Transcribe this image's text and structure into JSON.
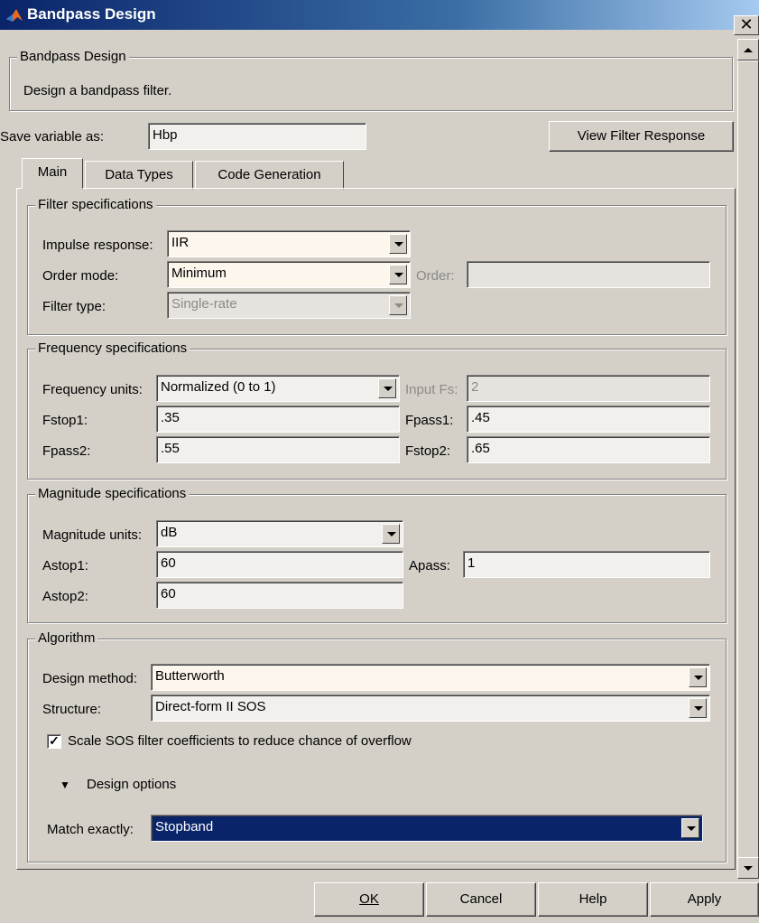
{
  "window": {
    "title": "Bandpass Design",
    "close_label": "✕"
  },
  "header": {
    "group_title": "Bandpass Design",
    "description": "Design a bandpass filter."
  },
  "save": {
    "label": "Save variable as:",
    "value": "Hbp",
    "view_button": "View Filter Response"
  },
  "tabs": [
    {
      "label": "Main"
    },
    {
      "label": "Data Types"
    },
    {
      "label": "Code Generation"
    }
  ],
  "filter_specs": {
    "title": "Filter specifications",
    "impulse_label": "Impulse response:",
    "impulse_value": "IIR",
    "order_mode_label": "Order mode:",
    "order_mode_value": "Minimum",
    "order_label": "Order:",
    "order_value": "",
    "filter_type_label": "Filter type:",
    "filter_type_value": "Single-rate"
  },
  "freq_specs": {
    "title": "Frequency specifications",
    "units_label": "Frequency units:",
    "units_value": "Normalized (0 to 1)",
    "input_fs_label": "Input Fs:",
    "input_fs_value": "2",
    "fstop1_label": "Fstop1:",
    "fstop1_value": ".35",
    "fpass1_label": "Fpass1:",
    "fpass1_value": ".45",
    "fpass2_label": "Fpass2:",
    "fpass2_value": ".55",
    "fstop2_label": "Fstop2:",
    "fstop2_value": ".65"
  },
  "mag_specs": {
    "title": "Magnitude specifications",
    "units_label": "Magnitude units:",
    "units_value": "dB",
    "astop1_label": "Astop1:",
    "astop1_value": "60",
    "apass_label": "Apass:",
    "apass_value": "1",
    "astop2_label": "Astop2:",
    "astop2_value": "60"
  },
  "algorithm": {
    "title": "Algorithm",
    "method_label": "Design method:",
    "method_value": "Butterworth",
    "structure_label": "Structure:",
    "structure_value": "Direct-form II SOS",
    "scale_label": "Scale SOS filter coefficients to reduce chance of overflow",
    "scale_checked": true,
    "design_options_label": "Design options",
    "match_label": "Match exactly:",
    "match_value": "Stopband"
  },
  "footer": {
    "ok": "OK",
    "cancel": "Cancel",
    "help": "Help",
    "apply": "Apply"
  }
}
